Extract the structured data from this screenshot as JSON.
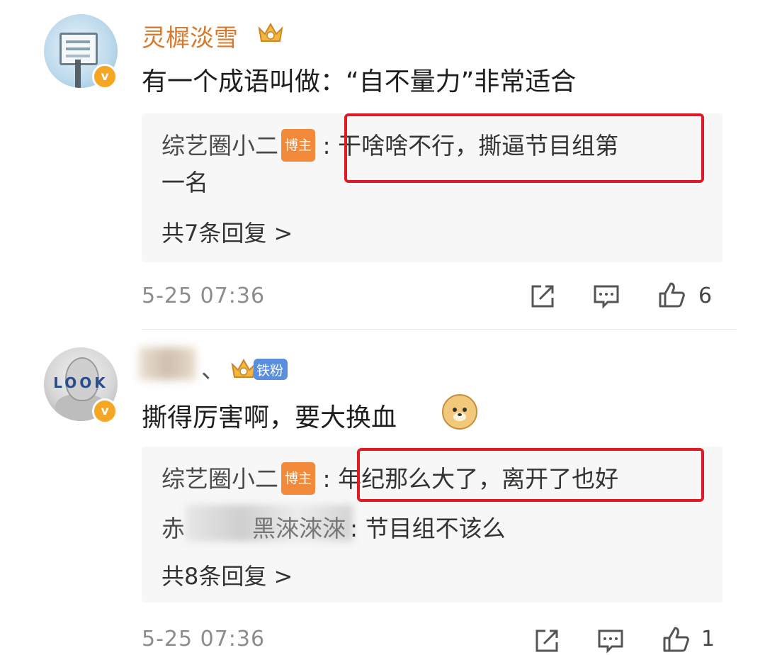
{
  "comments": [
    {
      "username": "灵樨淡雪",
      "text": "有一个成语叫做：“自不量力”非常适合",
      "reply": {
        "author": "综艺圈小二",
        "author_badge": "博主",
        "sep": ":",
        "text_line1": "干啥啥不行，撕逼节目组第",
        "text_line2": "一名"
      },
      "more_replies": "共7条回复 >",
      "timestamp": "5-25 07:36",
      "like_count": "6"
    },
    {
      "username_suffix": "、",
      "fan_badge": "铁粉",
      "text": "撕得厉害啊，要大换血",
      "reply": {
        "author": "综艺圈小二",
        "author_badge": "博主",
        "sep": ":",
        "text": "年纪那么大了，离开了也好"
      },
      "reply2": {
        "author_visible_start": "赤",
        "author_visible_end": "黑淶淶淶",
        "text": ": 节目组不该么"
      },
      "more_replies": "共8条回复 >",
      "timestamp": "5-25 07:36",
      "like_count": "1"
    }
  ],
  "avatar_text": "LOOK",
  "verified_mark": "v",
  "icons": [
    "share-icon",
    "comment-icon",
    "like-icon"
  ],
  "colors": {
    "username": "#d9792a",
    "highlight_box": "#e11a24",
    "blogger_badge": "#f38a3b",
    "fan_badge": "#5a8fe0"
  }
}
